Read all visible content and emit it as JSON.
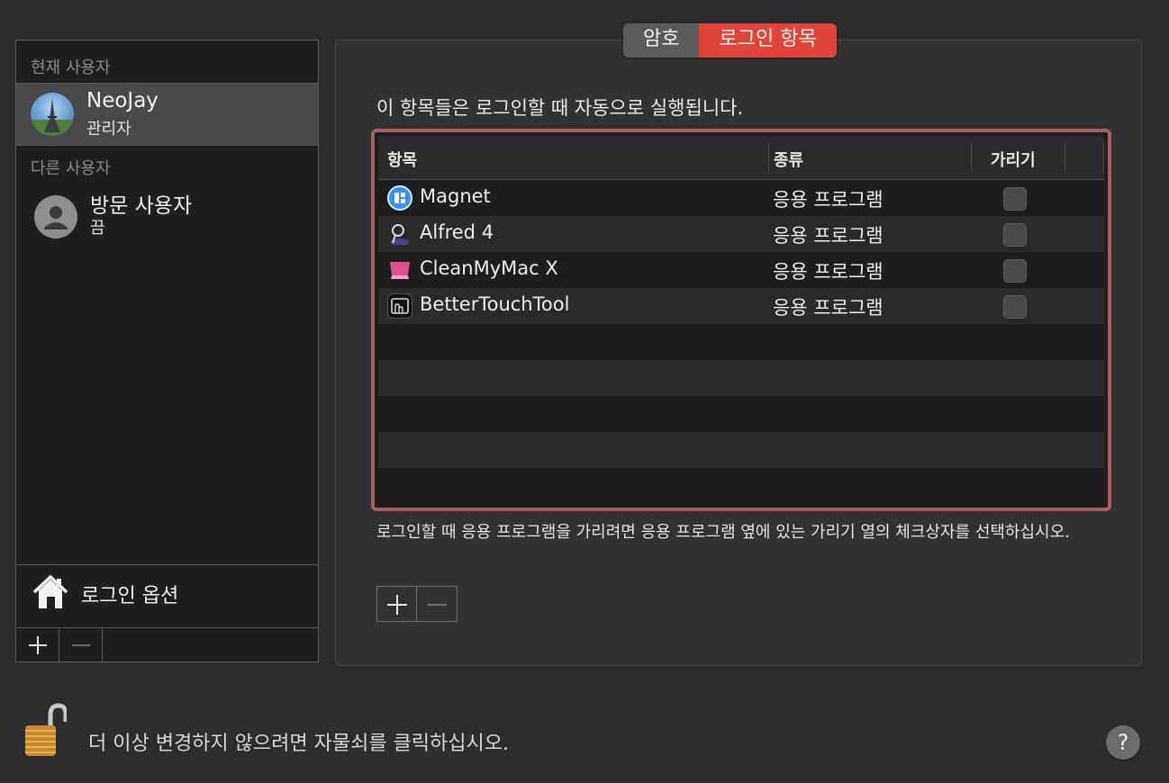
{
  "users": {
    "current_label": "현재 사용자",
    "current_user": {
      "name": "NeoJay",
      "role": "관리자",
      "avatar_icon": "user-photo-avatar"
    },
    "other_label": "다른 사용자",
    "other_users": [
      {
        "name": "방문 사용자",
        "status": "끔",
        "avatar_icon": "guest-user-icon"
      }
    ],
    "login_options_label": "로그인 옵션",
    "toolbar": {
      "add_icon": "plus-icon",
      "remove_icon": "minus-icon"
    }
  },
  "tabs": [
    {
      "label": "암호",
      "selected": false
    },
    {
      "label": "로그인 항목",
      "selected": true
    }
  ],
  "accent_color": "#e1453a",
  "intro_text": "이 항목들은 로그인할 때 자동으로 실행됩니다.",
  "table": {
    "columns": [
      "항목",
      "종류",
      "가리기"
    ],
    "rows": [
      {
        "name": "Magnet",
        "kind": "응용 프로그램",
        "hidden": false,
        "icon": "magnet-app-icon"
      },
      {
        "name": "Alfred 4",
        "kind": "응용 프로그램",
        "hidden": false,
        "icon": "alfred-app-icon"
      },
      {
        "name": "CleanMyMac X",
        "kind": "응용 프로그램",
        "hidden": false,
        "icon": "cleanmymac-app-icon"
      },
      {
        "name": "BetterTouchTool",
        "kind": "응용 프로그램",
        "hidden": false,
        "icon": "bettertouchtool-app-icon"
      }
    ]
  },
  "hint_text": "로그인할 때 응용 프로그램을 가리려면 응용 프로그램 옆에 있는 가리기 열의 체크상자를 선택하십시오.",
  "lock_text": "더 이상 변경하지 않으려면 자물쇠를 클릭하십시오.",
  "help_label": "?"
}
